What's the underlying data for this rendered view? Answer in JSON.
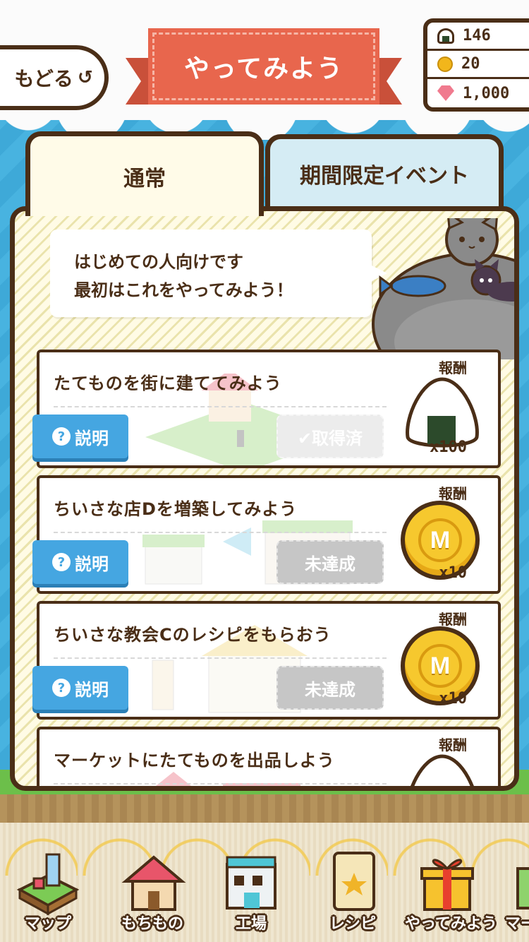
{
  "header": {
    "back_label": "もどる",
    "title": "やってみよう"
  },
  "currency": {
    "rice": "146",
    "coin": "20",
    "gem": "1,000"
  },
  "tabs": [
    {
      "label": "通常",
      "active": true
    },
    {
      "label": "期間限定イベント",
      "active": false
    }
  ],
  "intro": {
    "line1": "はじめての人向けです",
    "line2": "最初はこれをやってみよう！"
  },
  "missions": [
    {
      "title": "たてものを街に建ててみよう",
      "help_label": "説明",
      "status": "✔取得済",
      "reward_label": "報酬",
      "reward_icon": "onigiri-icon",
      "reward_qty": "x100"
    },
    {
      "title": "ちいさな店Dを増築してみよう",
      "help_label": "説明",
      "status": "未達成",
      "reward_label": "報酬",
      "reward_icon": "m-coin-icon",
      "reward_qty": "x10"
    },
    {
      "title": "ちいさな教会Cのレシピをもらおう",
      "help_label": "説明",
      "status": "未達成",
      "reward_label": "報酬",
      "reward_icon": "m-coin-icon",
      "reward_qty": "x10"
    },
    {
      "title": "マーケットにたてものを出品しよう",
      "reward_label": "報酬",
      "reward_icon": "onigiri-icon"
    }
  ],
  "coin_letter": "M",
  "nav": [
    {
      "label": "マップ",
      "icon": "map-icon"
    },
    {
      "label": "もちもの",
      "icon": "house-icon"
    },
    {
      "label": "工場",
      "icon": "factory-icon"
    },
    {
      "label": "レシピ",
      "icon": "recipe-book-icon"
    },
    {
      "label": "やってみよう",
      "icon": "gift-icon"
    },
    {
      "label": "マー",
      "icon": "market-icon"
    }
  ],
  "colors": {
    "outline": "#4a2e17",
    "ribbon": "#e8664d",
    "help_button": "#45a6e1",
    "status_button": "#c6c6c6",
    "sky": "#48b3e0"
  }
}
